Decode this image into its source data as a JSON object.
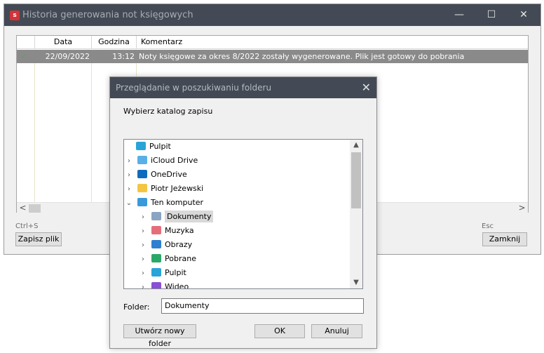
{
  "window": {
    "title": "Historia generowania not księgowych",
    "app_icon_letter": "s",
    "buttons": {
      "minimize": "—",
      "maximize": "☐",
      "close": "✕"
    }
  },
  "grid": {
    "columns": [
      "Data",
      "Godzina",
      "Komentarz"
    ],
    "rows": [
      {
        "status_icon": "✓",
        "date": "22/09/2022",
        "time": "13:12",
        "comment": "Noty księgowe za okres 8/2022 zostały wygenerowane. Plik jest gotowy do pobrania"
      }
    ],
    "scroll_left": "<",
    "scroll_right": ">"
  },
  "footer": {
    "save_shortcut": "Ctrl+S",
    "save_label": "Zapisz plik",
    "close_shortcut": "Esc",
    "close_label": "Zamknij"
  },
  "dialog": {
    "title": "Przeglądanie w poszukiwaniu folderu",
    "close_glyph": "✕",
    "instruction": "Wybierz katalog zapisu",
    "tree": [
      {
        "label": "Pulpit",
        "icon": "desktop-icon",
        "chev": "",
        "indent": 0
      },
      {
        "label": "iCloud Drive",
        "icon": "icloud-icon",
        "chev": "›",
        "indent": 1
      },
      {
        "label": "OneDrive",
        "icon": "onedrive-icon",
        "chev": "›",
        "indent": 1
      },
      {
        "label": "Piotr Jeżewski",
        "icon": "user-folder-icon",
        "chev": "›",
        "indent": 1
      },
      {
        "label": "Ten komputer",
        "icon": "computer-icon",
        "chev": "⌄",
        "indent": 1
      },
      {
        "label": "Dokumenty",
        "icon": "documents-icon",
        "chev": "›",
        "indent": 2,
        "selected": true
      },
      {
        "label": "Muzyka",
        "icon": "music-icon",
        "chev": "›",
        "indent": 2
      },
      {
        "label": "Obrazy",
        "icon": "pictures-icon",
        "chev": "›",
        "indent": 2
      },
      {
        "label": "Pobrane",
        "icon": "downloads-icon",
        "chev": "›",
        "indent": 2
      },
      {
        "label": "Pulpit",
        "icon": "desktop-icon",
        "chev": "›",
        "indent": 2
      },
      {
        "label": "Wideo",
        "icon": "video-icon",
        "chev": "›",
        "indent": 2
      }
    ],
    "folder_label": "Folder:",
    "folder_value": "Dokumenty",
    "new_folder_label": "Utwórz nowy folder",
    "ok_label": "OK",
    "cancel_label": "Anuluj"
  },
  "colors": {
    "titlebar": "#434a55",
    "selection": "#8a8a8a",
    "check": "#5fa05f"
  }
}
